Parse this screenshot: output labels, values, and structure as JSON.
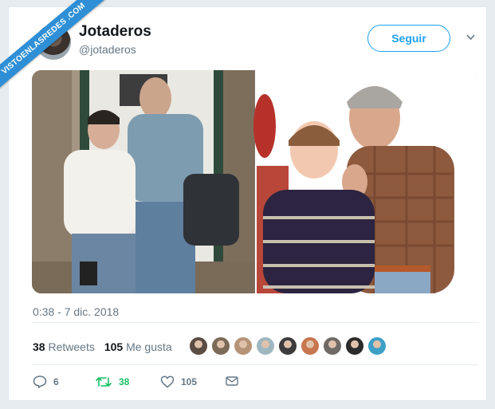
{
  "watermark": {
    "text": "VISTOENLASREDES .COM"
  },
  "tweet": {
    "display_name": "Jotaderos",
    "handle": "@jotaderos",
    "follow_label": "Seguir",
    "timestamp": "0:38 - 7 dic. 2018",
    "stats": {
      "retweets_count": "38",
      "retweets_label": "Retweets",
      "likes_count": "105",
      "likes_label": "Me gusta"
    },
    "actions": {
      "reply_count": "6",
      "retweet_count": "38",
      "like_count": "105"
    },
    "liker_colors": [
      "#5b4c44",
      "#7c6a58",
      "#b59376",
      "#9fb7c0",
      "#3d3b3c",
      "#c7764f",
      "#6f6a66",
      "#2b2b2b",
      "#3ea0c7"
    ]
  },
  "colors": {
    "accent": "#1da1f2",
    "retweet_green": "#17bf63",
    "muted": "#657786"
  }
}
